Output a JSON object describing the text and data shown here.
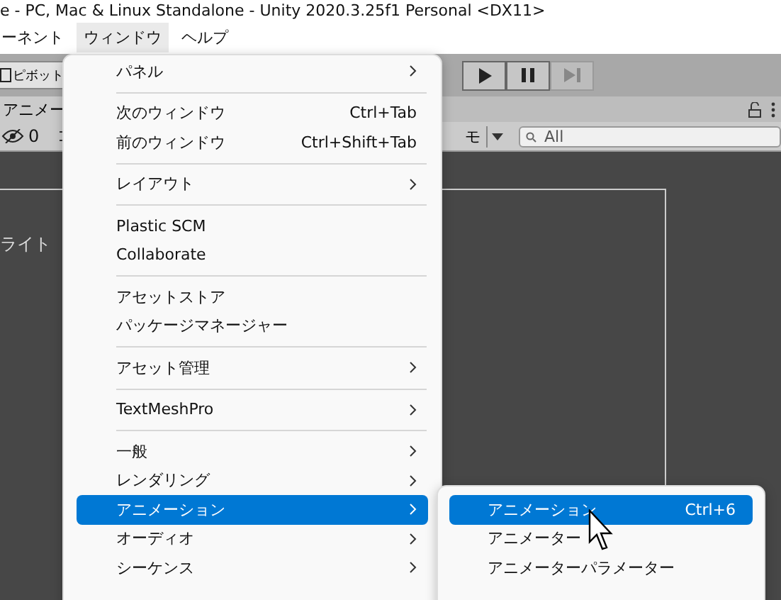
{
  "window": {
    "title": "e - PC, Mac & Linux Standalone - Unity 2020.3.25f1 Personal <DX11>"
  },
  "menu_bar": [
    {
      "label": "ーネント",
      "selected": false
    },
    {
      "label": "ウィンドウ",
      "selected": true
    },
    {
      "label": "ヘルプ",
      "selected": false
    }
  ],
  "toolbar": {
    "pivot_button": "ピボット"
  },
  "panel_tab": {
    "label": "アニメー"
  },
  "scene_toolbar": {
    "hidden_count": "0",
    "dropdown": "モ",
    "search": {
      "placeholder": "All"
    }
  },
  "scene_text": "ライト",
  "window_menu": [
    {
      "kind": "item",
      "label": "パネル",
      "submenu": true,
      "selected": false
    },
    {
      "kind": "separator"
    },
    {
      "kind": "item",
      "label": "次のウィンドウ",
      "shortcut": "Ctrl+Tab",
      "submenu": false,
      "selected": false
    },
    {
      "kind": "item",
      "label": "前のウィンドウ",
      "shortcut": "Ctrl+Shift+Tab",
      "submenu": false,
      "selected": false
    },
    {
      "kind": "separator"
    },
    {
      "kind": "item",
      "label": "レイアウト",
      "submenu": true,
      "selected": false
    },
    {
      "kind": "separator"
    },
    {
      "kind": "item",
      "label": "Plastic SCM",
      "submenu": false,
      "selected": false
    },
    {
      "kind": "item",
      "label": "Collaborate",
      "submenu": false,
      "selected": false
    },
    {
      "kind": "separator"
    },
    {
      "kind": "item",
      "label": "アセットストア",
      "submenu": false,
      "selected": false
    },
    {
      "kind": "item",
      "label": "パッケージマネージャー",
      "submenu": false,
      "selected": false
    },
    {
      "kind": "separator"
    },
    {
      "kind": "item",
      "label": "アセット管理",
      "submenu": true,
      "selected": false
    },
    {
      "kind": "separator"
    },
    {
      "kind": "item",
      "label": "TextMeshPro",
      "submenu": true,
      "selected": false
    },
    {
      "kind": "separator"
    },
    {
      "kind": "item",
      "label": "一般",
      "submenu": true,
      "selected": false
    },
    {
      "kind": "item",
      "label": "レンダリング",
      "submenu": true,
      "selected": false
    },
    {
      "kind": "item",
      "label": "アニメーション",
      "submenu": true,
      "selected": true
    },
    {
      "kind": "item",
      "label": "オーディオ",
      "submenu": true,
      "selected": false
    },
    {
      "kind": "item",
      "label": "シーケンス",
      "submenu": true,
      "selected": false
    }
  ],
  "animation_submenu": [
    {
      "label": "アニメーション",
      "shortcut": "Ctrl+6",
      "selected": true
    },
    {
      "label": "アニメーター",
      "selected": false
    },
    {
      "label": "アニメーターパラメーター",
      "selected": false
    }
  ]
}
